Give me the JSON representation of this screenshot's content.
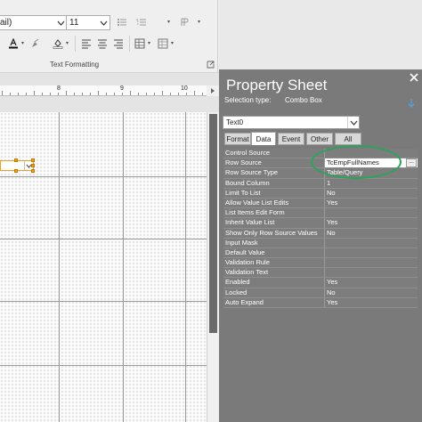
{
  "ribbon": {
    "font_name_partial": "ail)",
    "font_size": "11",
    "group_label": "Text Formatting",
    "icons": [
      "bold-icon",
      "italic-icon",
      "underline-icon",
      "bullets-icon",
      "numbering-icon",
      "paragraph-direction-icon",
      "font-color-icon",
      "highlight-icon",
      "fill-color-icon",
      "align-left-icon",
      "align-center-icon",
      "align-right-icon",
      "decrease-indent-icon",
      "increase-indent-icon",
      "alternate-row-color-icon",
      "conditional-formatting-icon",
      "dialog-launcher-icon"
    ]
  },
  "ruler": {
    "numbers": [
      "8",
      "9",
      "10"
    ]
  },
  "property_sheet": {
    "title": "Property Sheet",
    "selection_type_label": "Selection type:",
    "selection_type_value": "Combo Box",
    "object_select": "Text0",
    "tabs": [
      {
        "label": "Format",
        "active": false
      },
      {
        "label": "Data",
        "active": true
      },
      {
        "label": "Event",
        "active": false
      },
      {
        "label": "Other",
        "active": false
      },
      {
        "label": "All",
        "active": false
      }
    ],
    "rows": [
      {
        "label": "Control Source",
        "value": ""
      },
      {
        "label": "Row Source",
        "value": "TcEmpFullNames"
      },
      {
        "label": "Row Source Type",
        "value": "Table/Query"
      },
      {
        "label": "Bound Column",
        "value": "1"
      },
      {
        "label": "Limit To List",
        "value": "No"
      },
      {
        "label": "Allow Value List Edits",
        "value": "Yes"
      },
      {
        "label": "List Items Edit Form",
        "value": ""
      },
      {
        "label": "Inherit Value List",
        "value": "Yes"
      },
      {
        "label": "Show Only Row Source Values",
        "value": "No"
      },
      {
        "label": "Input Mask",
        "value": ""
      },
      {
        "label": "Default Value",
        "value": ""
      },
      {
        "label": "Validation Rule",
        "value": ""
      },
      {
        "label": "Validation Text",
        "value": ""
      },
      {
        "label": "Enabled",
        "value": "Yes"
      },
      {
        "label": "Locked",
        "value": "No"
      },
      {
        "label": "Auto Expand",
        "value": "Yes"
      }
    ],
    "builder_label": "...",
    "highlight_color": "#2aa35b"
  },
  "colors": {
    "panel_bg": "#7a7a7a",
    "selection_orange": "#f0a020"
  }
}
